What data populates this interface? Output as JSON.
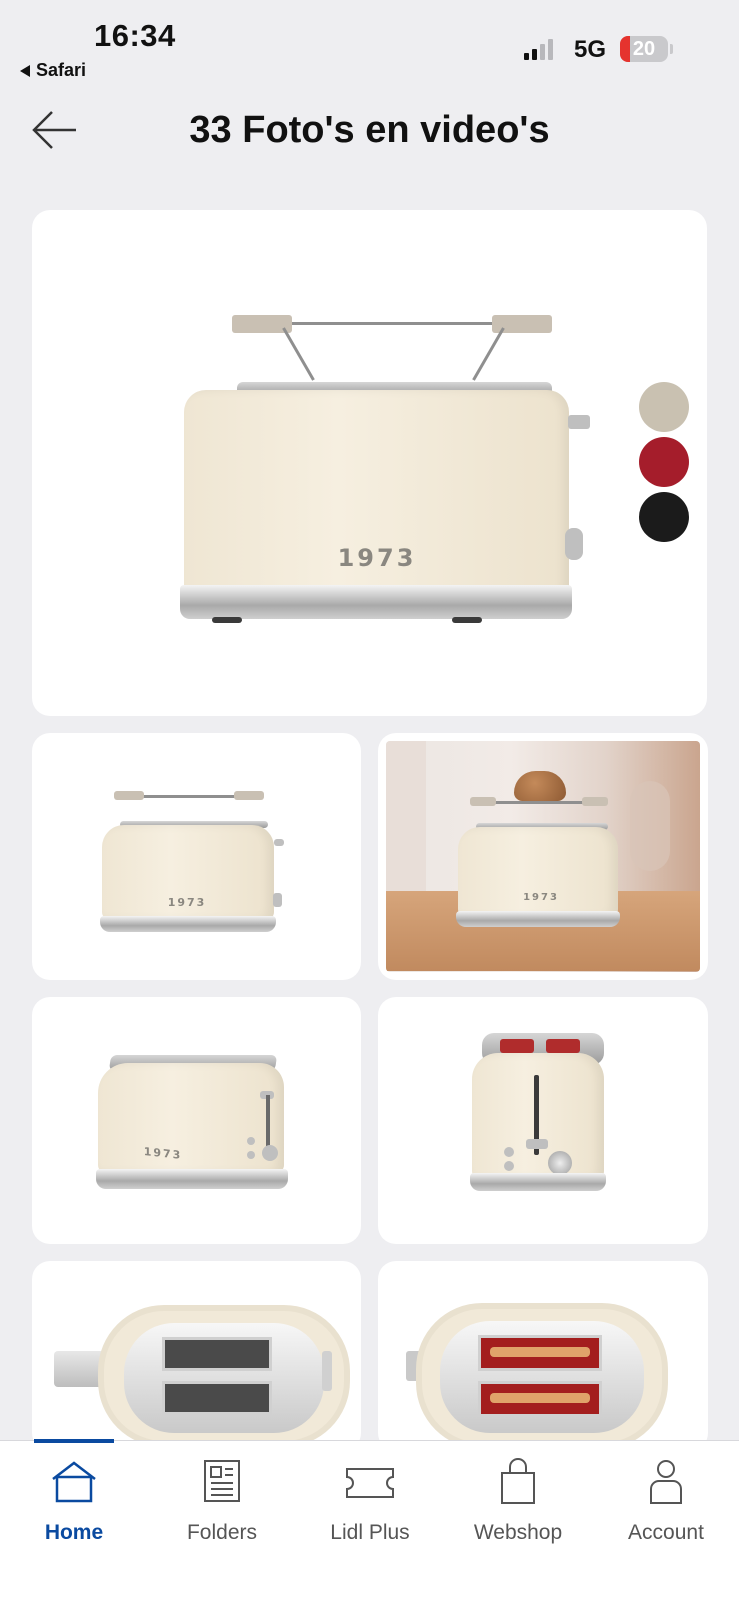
{
  "status_bar": {
    "time": "16:34",
    "back_app": "Safari",
    "network": "5G",
    "battery": "20"
  },
  "header": {
    "title": "33 Foto's en video's",
    "back_icon": "arrow-left-icon"
  },
  "gallery": {
    "main_photo_label": "1973",
    "swatches": [
      "#c9c1b1",
      "#a51d2b",
      "#1b1b1b"
    ],
    "thumb_labels": [
      "1973",
      "1973",
      "1973"
    ]
  },
  "nav": {
    "items": [
      {
        "label": "Home",
        "icon": "home-icon",
        "active": true
      },
      {
        "label": "Folders",
        "icon": "newspaper-icon",
        "active": false
      },
      {
        "label": "Lidl Plus",
        "icon": "ticket-icon",
        "active": false
      },
      {
        "label": "Webshop",
        "icon": "shopping-bag-icon",
        "active": false
      },
      {
        "label": "Account",
        "icon": "user-icon",
        "active": false
      }
    ]
  },
  "colors": {
    "accent": "#0a4aa0",
    "background": "#eeeef1"
  }
}
